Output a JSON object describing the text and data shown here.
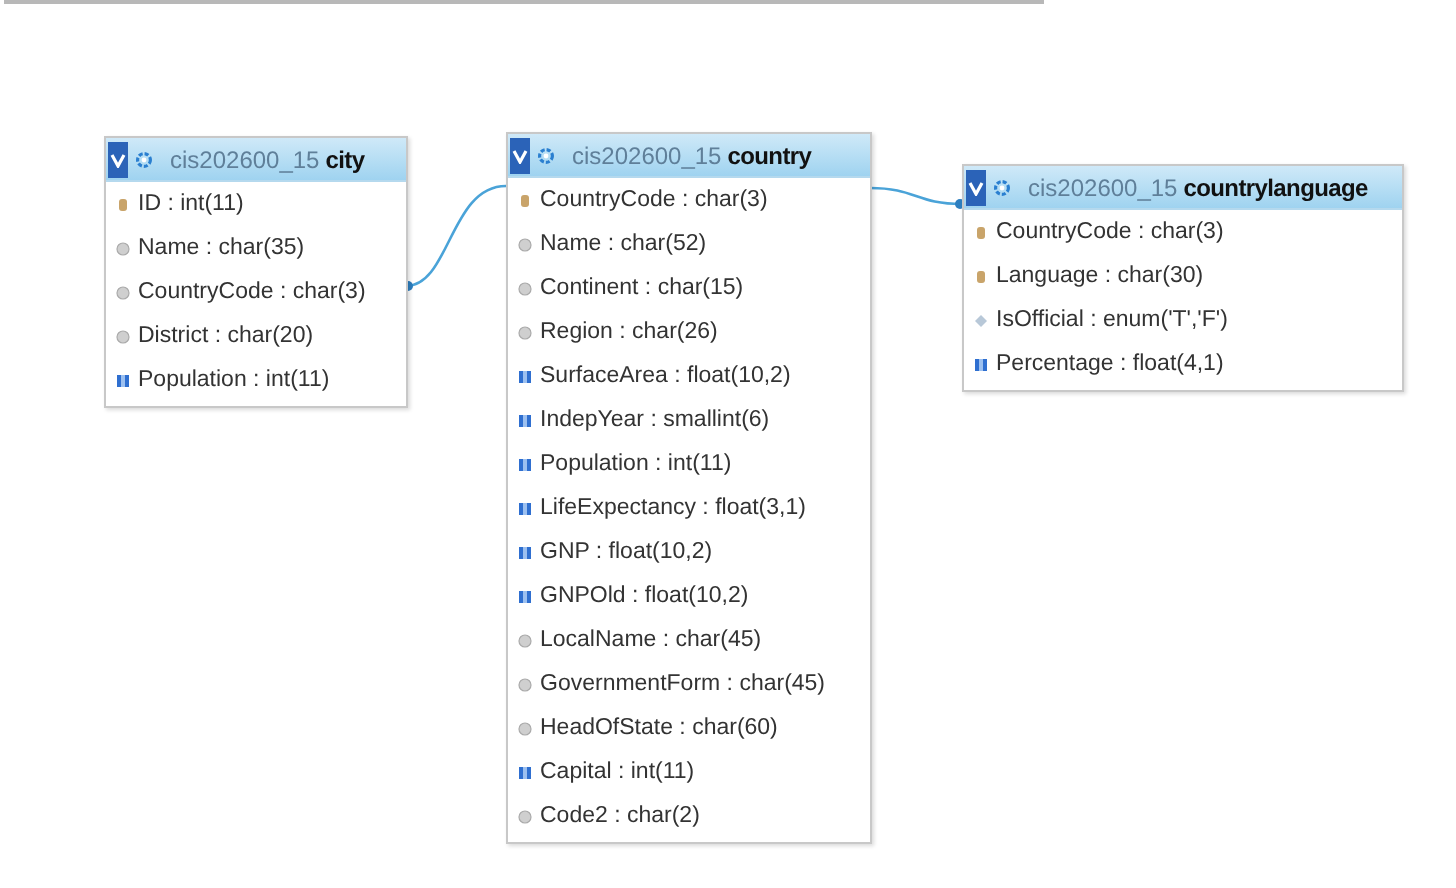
{
  "tables": [
    {
      "schema": "cis202600_15",
      "name": "city",
      "columns": [
        {
          "kind": "key",
          "label": "ID : int(11)"
        },
        {
          "kind": "text",
          "label": "Name : char(35)"
        },
        {
          "kind": "text",
          "label": "CountryCode : char(3)"
        },
        {
          "kind": "text",
          "label": "District : char(20)"
        },
        {
          "kind": "number",
          "label": "Population : int(11)"
        }
      ]
    },
    {
      "schema": "cis202600_15",
      "name": "country",
      "columns": [
        {
          "kind": "key",
          "label": "CountryCode : char(3)"
        },
        {
          "kind": "text",
          "label": "Name : char(52)"
        },
        {
          "kind": "text",
          "label": "Continent : char(15)"
        },
        {
          "kind": "text",
          "label": "Region : char(26)"
        },
        {
          "kind": "number",
          "label": "SurfaceArea : float(10,2)"
        },
        {
          "kind": "number",
          "label": "IndepYear : smallint(6)"
        },
        {
          "kind": "number",
          "label": "Population : int(11)"
        },
        {
          "kind": "number",
          "label": "LifeExpectancy : float(3,1)"
        },
        {
          "kind": "number",
          "label": "GNP : float(10,2)"
        },
        {
          "kind": "number",
          "label": "GNPOld : float(10,2)"
        },
        {
          "kind": "text",
          "label": "LocalName : char(45)"
        },
        {
          "kind": "text",
          "label": "GovernmentForm : char(45)"
        },
        {
          "kind": "text",
          "label": "HeadOfState : char(60)"
        },
        {
          "kind": "number",
          "label": "Capital : int(11)"
        },
        {
          "kind": "text",
          "label": "Code2 : char(2)"
        }
      ]
    },
    {
      "schema": "cis202600_15",
      "name": "countrylanguage",
      "columns": [
        {
          "kind": "key",
          "label": "CountryCode : char(3)"
        },
        {
          "kind": "key",
          "label": "Language : char(30)"
        },
        {
          "kind": "enum",
          "label": "IsOfficial : enum('T','F')"
        },
        {
          "kind": "number",
          "label": "Percentage : float(4,1)"
        }
      ]
    }
  ]
}
